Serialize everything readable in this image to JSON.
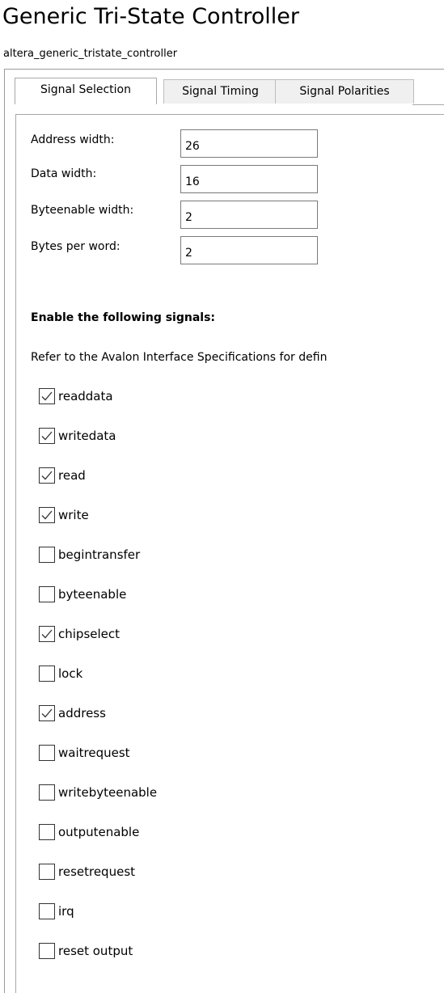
{
  "header": {
    "title": "Generic Tri-State Controller",
    "subtitle": "altera_generic_tristate_controller"
  },
  "tabs": [
    {
      "label": "Signal Selection",
      "active": true
    },
    {
      "label": "Signal Timing",
      "active": false
    },
    {
      "label": "Signal Polarities",
      "active": false
    }
  ],
  "fields": [
    {
      "label": "Address width:",
      "value": "26"
    },
    {
      "label": "Data width:",
      "value": "16"
    },
    {
      "label": "Byteenable width:",
      "value": "2"
    },
    {
      "label": "Bytes per word:",
      "value": "2"
    }
  ],
  "signals_section": {
    "heading": "Enable the following signals:",
    "intro": "Refer to the Avalon Interface Specifications for defin"
  },
  "signals": [
    {
      "label": "readdata",
      "checked": true
    },
    {
      "label": "writedata",
      "checked": true
    },
    {
      "label": "read",
      "checked": true
    },
    {
      "label": "write",
      "checked": true
    },
    {
      "label": "begintransfer",
      "checked": false
    },
    {
      "label": "byteenable",
      "checked": false
    },
    {
      "label": "chipselect",
      "checked": true
    },
    {
      "label": "lock",
      "checked": false
    },
    {
      "label": "address",
      "checked": true
    },
    {
      "label": "waitrequest",
      "checked": false
    },
    {
      "label": "writebyteenable",
      "checked": false
    },
    {
      "label": "outputenable",
      "checked": false
    },
    {
      "label": "resetrequest",
      "checked": false
    },
    {
      "label": "irq",
      "checked": false
    },
    {
      "label": "reset output",
      "checked": false
    }
  ],
  "icons": {
    "checkmark": "checkmark-icon"
  },
  "colors": {
    "border": "#9b9b9b",
    "tab_inactive_bg": "#f0f0f0",
    "checkbox_border": "#333333",
    "check_stroke": "#333333"
  }
}
